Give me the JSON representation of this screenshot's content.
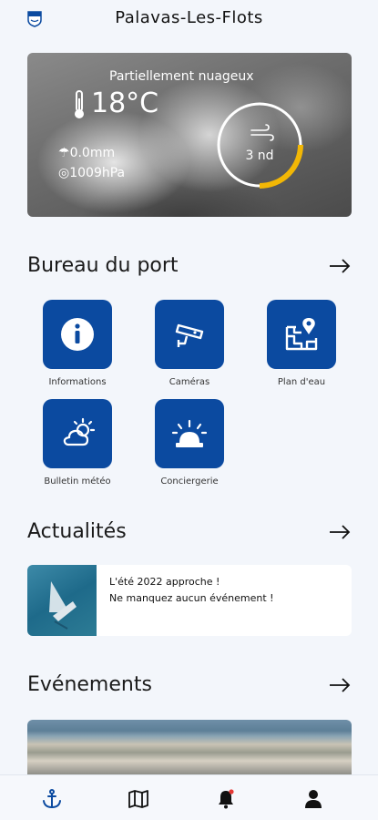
{
  "header": {
    "title": "Palavas-Les-Flots",
    "crest_icon": "town-crest-icon"
  },
  "weather": {
    "condition": "Partiellement nuageux",
    "temperature": "18°C",
    "rain": "0.0mm",
    "pressure": "1009hPa",
    "wind": "3 nd",
    "wind_level": 0.25,
    "accent": "#f2b705"
  },
  "bureau": {
    "title": "Bureau du port",
    "tiles": [
      {
        "label": "Informations",
        "icon": "info-icon"
      },
      {
        "label": "Caméras",
        "icon": "camera-icon"
      },
      {
        "label": "Plan d'eau",
        "icon": "map-pin-icon"
      },
      {
        "label": "Bulletin météo",
        "icon": "weather-icon"
      },
      {
        "label": "Conciergerie",
        "icon": "siren-icon"
      }
    ]
  },
  "actualites": {
    "title": "Actualités",
    "item": {
      "title": "L'été 2022 approche !",
      "subtitle": "Ne manquez aucun événement !"
    }
  },
  "evenements": {
    "title": "Evénements"
  },
  "nav": {
    "items": [
      "anchor-icon",
      "map-icon",
      "bell-icon",
      "user-icon"
    ],
    "active_color": "#0b4aa0",
    "badge_color": "#e53935"
  },
  "colors": {
    "primary": "#0b4aa0",
    "background": "#f3f6fb"
  }
}
